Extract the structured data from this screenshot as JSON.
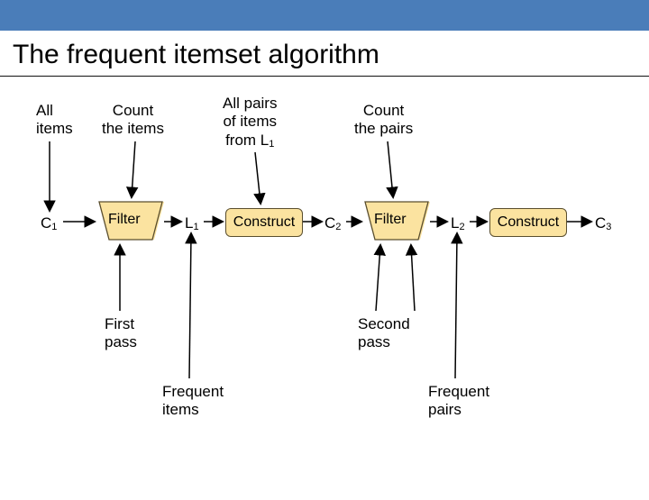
{
  "title": "The frequent itemset algorithm",
  "labels": {
    "all_items": "All\nitems",
    "count_items": "Count\nthe items",
    "all_pairs": "All pairs\nof items\nfrom L",
    "all_pairs_sub": "1",
    "count_pairs": "Count\nthe pairs",
    "first_pass": "First\npass",
    "second_pass": "Second\npass",
    "freq_items": "Frequent\nitems",
    "freq_pairs": "Frequent\npairs"
  },
  "nodes": {
    "c1": "C",
    "c1_sub": "1",
    "l1": "L",
    "l1_sub": "1",
    "c2": "C",
    "c2_sub": "2",
    "l2": "L",
    "l2_sub": "2",
    "c3": "C",
    "c3_sub": "3"
  },
  "shapes": {
    "filter": "Filter",
    "construct": "Construct"
  }
}
